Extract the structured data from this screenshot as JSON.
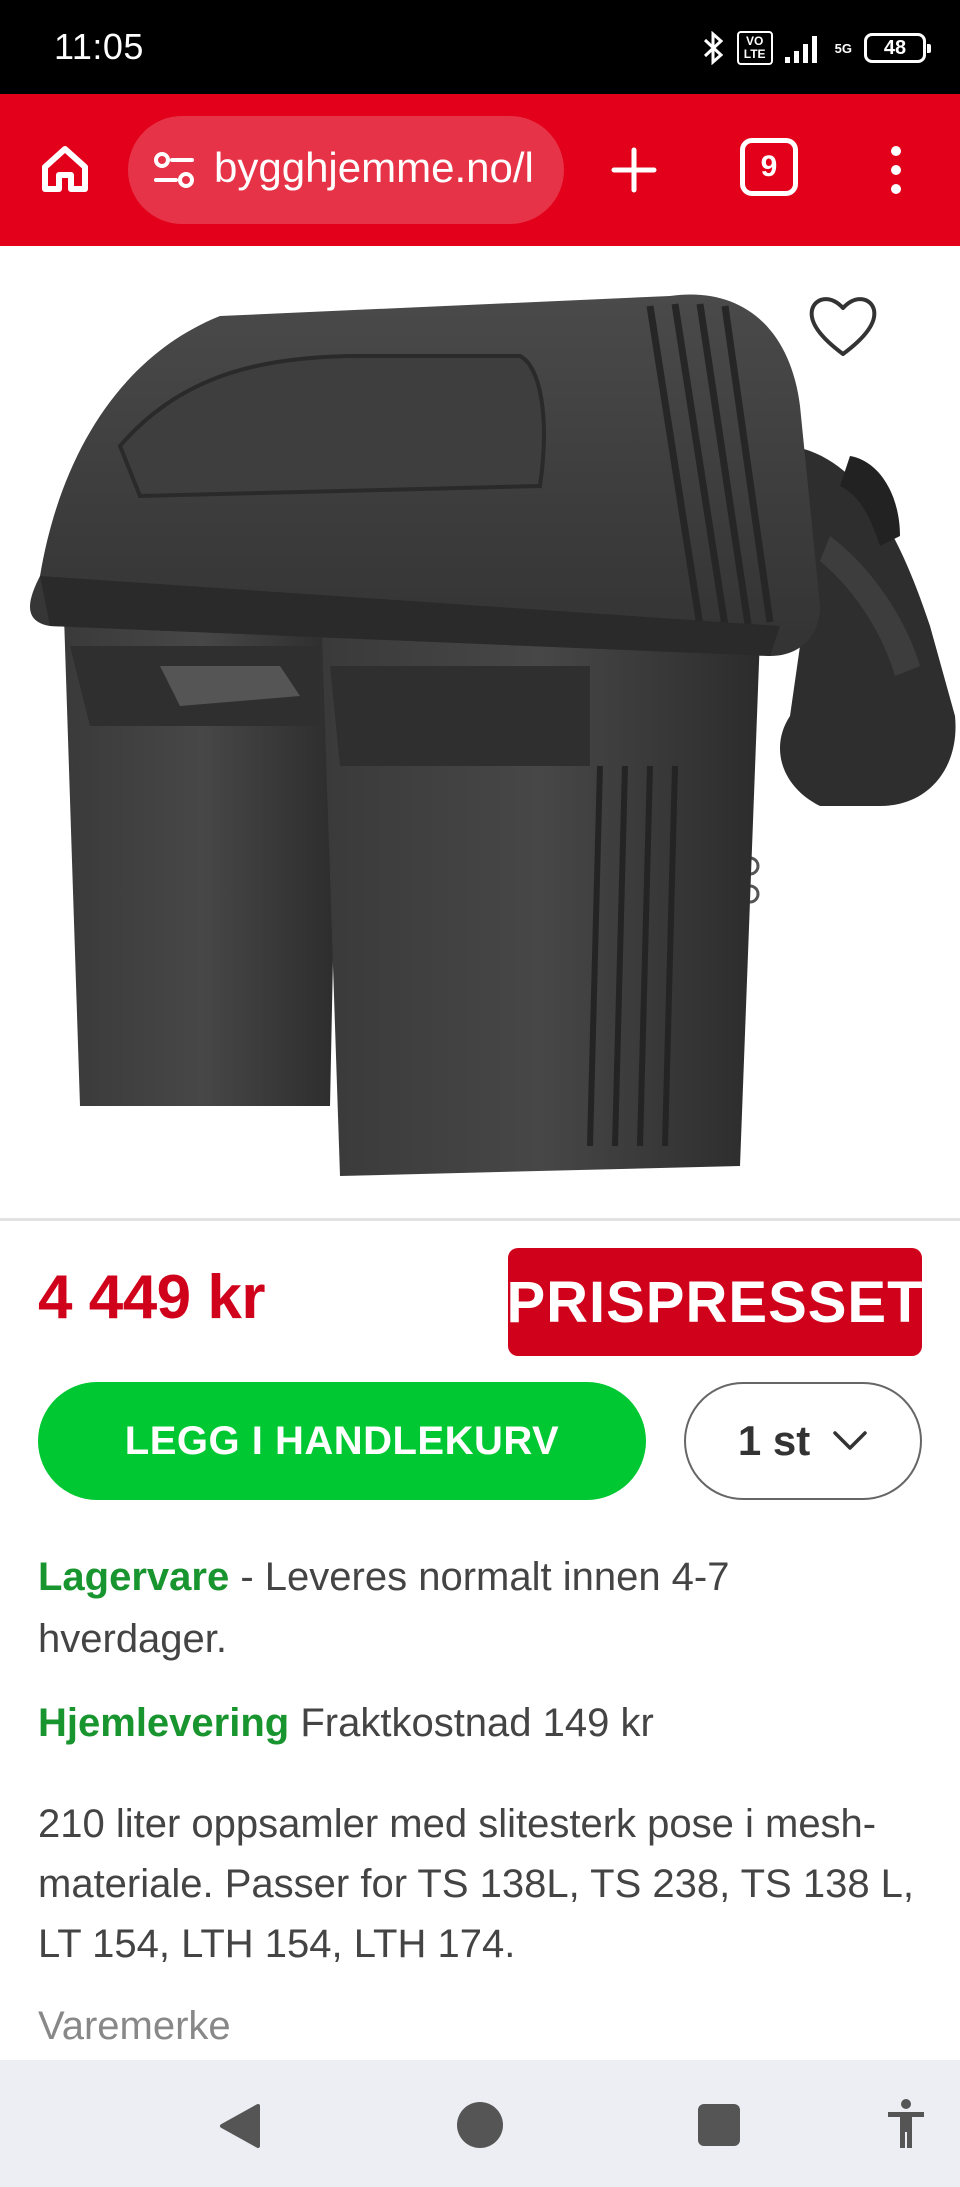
{
  "status_bar": {
    "time": "11:05",
    "volte_line1": "VO",
    "volte_line2": "LTE",
    "network": "5G",
    "battery": "48",
    "icons": [
      "bluetooth-icon",
      "volte-icon",
      "signal-icon",
      "5g-icon",
      "battery-icon"
    ]
  },
  "browser": {
    "url": "bygghjemme.no/l",
    "tab_count": "9",
    "icons": [
      "home-icon",
      "site-settings-icon",
      "plus-icon",
      "tabs-icon",
      "more-vert-icon"
    ]
  },
  "product": {
    "image_icon": "product-photo",
    "favorite_icon": "heart-outline-icon",
    "price": "4 449 kr",
    "badge": "PRISPRESSET",
    "add_to_cart": "LEGG I HANDLEKURV",
    "quantity": "1 st",
    "stock_status": "Lagervare",
    "stock_text": " - Leveres normalt innen 4-7 hverdager.",
    "delivery_label": "Hjemlevering",
    "delivery_text": " Fraktkostnad 149 kr",
    "description": "210 liter oppsamler med slitesterk pose i mesh-materiale. Passer for TS 138L, TS 238, TS 138 L, LT 154, LTH 154, LTH 174.",
    "brand_label": "Varemerke"
  },
  "nav_bar": {
    "icons": [
      "back-icon",
      "home-circle-icon",
      "recents-icon",
      "accessibility-icon"
    ]
  },
  "colors": {
    "brand_red": "#e2001a",
    "price_red": "#d0021b",
    "cart_green": "#00c832",
    "text_green": "#18952e"
  }
}
